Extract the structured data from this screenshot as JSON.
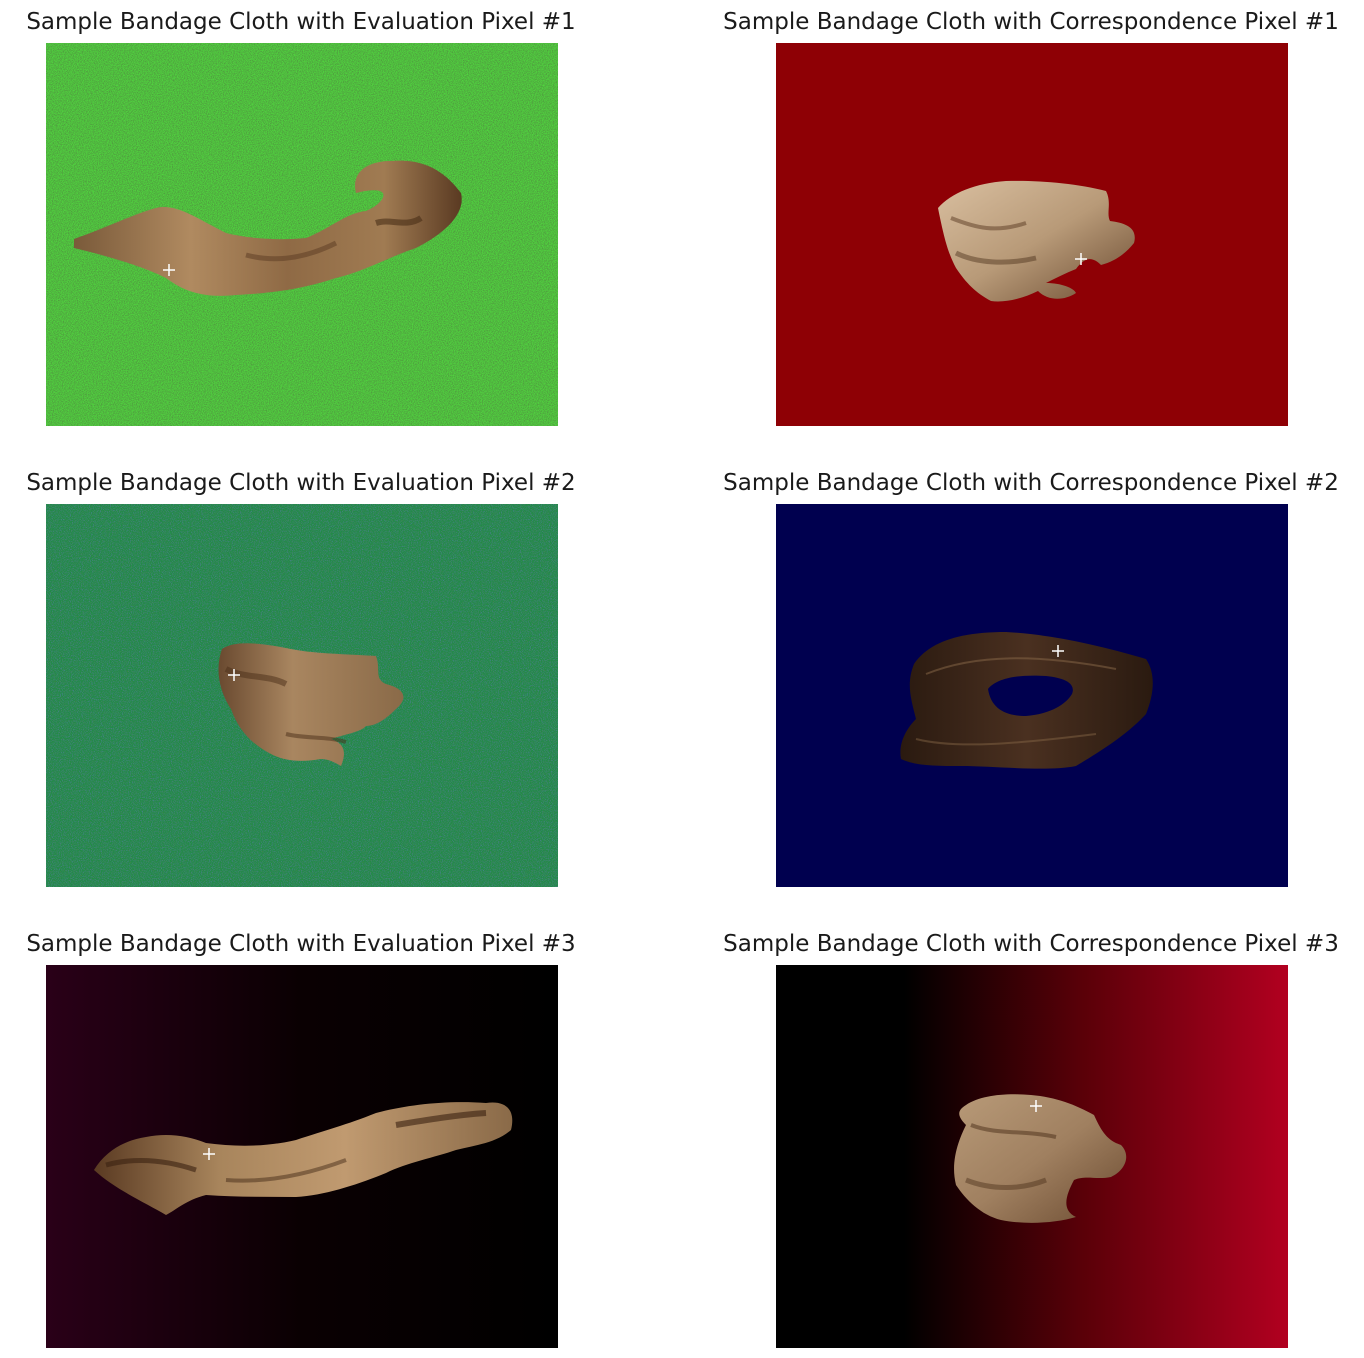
{
  "figure": {
    "panels": [
      {
        "title": "Sample Bandage Cloth with Evaluation Pixel #1",
        "background": "green-noise",
        "colors": [
          "#1f5a1a",
          "#0e2a0c",
          "#3aa634"
        ]
      },
      {
        "title": "Sample Bandage Cloth with Correspondence Pixel #1",
        "background": "solid",
        "colors": [
          "#8e0005"
        ]
      },
      {
        "title": "Sample Bandage Cloth with Evaluation Pixel #2",
        "background": "green-blue-noise",
        "colors": [
          "#1f8a44",
          "#1a3a6a",
          "#2a9a4a"
        ]
      },
      {
        "title": "Sample Bandage Cloth with Correspondence Pixel #2",
        "background": "solid",
        "colors": [
          "#00004f"
        ]
      },
      {
        "title": "Sample Bandage Cloth with Evaluation Pixel #3",
        "background": "gradient",
        "colors": [
          "#2a0018",
          "#000000"
        ]
      },
      {
        "title": "Sample Bandage Cloth with Correspondence Pixel #3",
        "background": "gradient",
        "colors": [
          "#000000",
          "#b00020"
        ]
      }
    ],
    "marker_color": "#ffffff",
    "cloth_color": "#8a6a4a"
  }
}
